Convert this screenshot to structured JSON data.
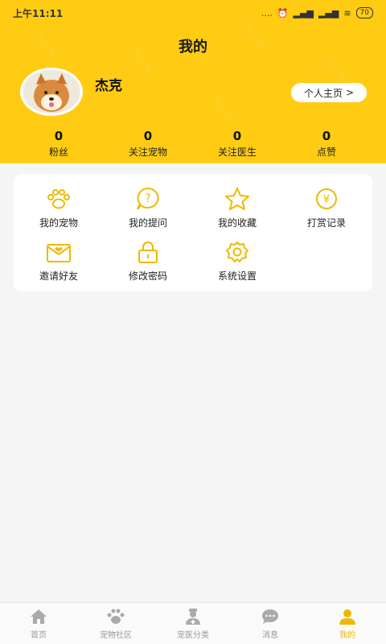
{
  "status_bar": {
    "time": "上午11:11",
    "signal": "....",
    "battery": "70"
  },
  "header": {
    "title": "我的",
    "username": "杰克",
    "homepage_button": "个人主页",
    "homepage_arrow": ">"
  },
  "stats": [
    {
      "value": "0",
      "label": "粉丝"
    },
    {
      "value": "0",
      "label": "关注宠物"
    },
    {
      "value": "0",
      "label": "关注医生"
    },
    {
      "value": "0",
      "label": "点赞"
    }
  ],
  "menu": [
    {
      "label": "我的宠物",
      "icon": "paw-icon"
    },
    {
      "label": "我的提问",
      "icon": "question-icon"
    },
    {
      "label": "我的收藏",
      "icon": "star-icon"
    },
    {
      "label": "打赏记录",
      "icon": "yen-icon"
    },
    {
      "label": "邀请好友",
      "icon": "invite-envelope-icon"
    },
    {
      "label": "修改密码",
      "icon": "lock-icon"
    },
    {
      "label": "系统设置",
      "icon": "gear-icon"
    }
  ],
  "tabs": [
    {
      "label": "首页",
      "icon": "home-icon"
    },
    {
      "label": "宠物社区",
      "icon": "paw-icon"
    },
    {
      "label": "宠医分类",
      "icon": "doctor-icon"
    },
    {
      "label": "消息",
      "icon": "message-icon"
    },
    {
      "label": "我的",
      "icon": "user-icon",
      "active": true
    }
  ],
  "colors": {
    "accent": "#ffcc13",
    "icon": "#f0b800",
    "tab_inactive": "#999999"
  }
}
